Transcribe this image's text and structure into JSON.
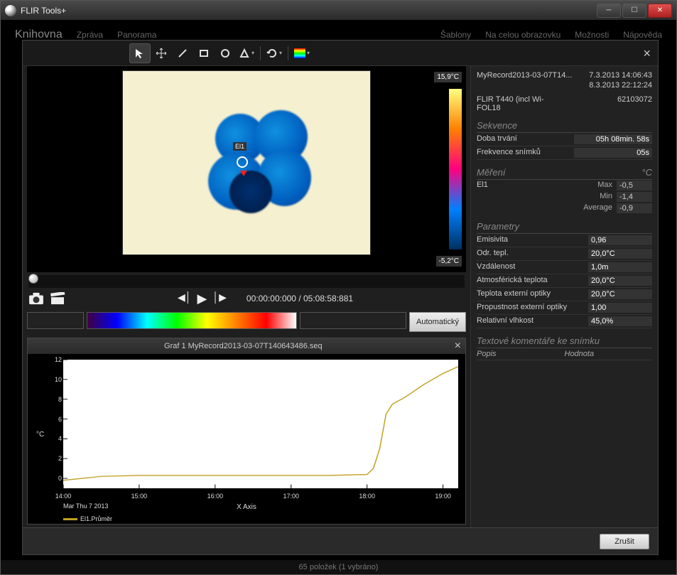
{
  "window": {
    "title": "FLIR Tools+"
  },
  "bg_menu": [
    "Knihovna",
    "Zpráva",
    "Panorama",
    "Šablony",
    "Na celou obrazovku",
    "Možnosti",
    "Nápověda"
  ],
  "toolbar": {
    "items": [
      "pointer",
      "move",
      "line",
      "rect",
      "circle",
      "delta",
      "rotate",
      "palette"
    ],
    "active": 0
  },
  "thermal": {
    "marker_label": "El1",
    "scale_max": "15,9°C",
    "scale_min": "-5,2°C"
  },
  "playback": {
    "current": "00:00:00:000",
    "total": "05:08:58:881"
  },
  "levelspan": {
    "auto_label": "Automatický"
  },
  "graph": {
    "title": "Graf 1 MyRecord2013-03-07T140643486.seq",
    "ylabel": "°C",
    "xlabel": "X Axis",
    "xdate": "Mar Thu 7 2013",
    "legend": "El1.Průměr"
  },
  "chart_data": {
    "type": "line",
    "title": "Graf 1 MyRecord2013-03-07T140643486.seq",
    "xlabel": "X Axis",
    "ylabel": "°C",
    "ylim": [
      -1,
      12
    ],
    "xticks": [
      "14:00",
      "15:00",
      "16:00",
      "17:00",
      "18:00",
      "19:00"
    ],
    "yticks": [
      0,
      2,
      4,
      6,
      8,
      10,
      12
    ],
    "series": [
      {
        "name": "El1.Průměr",
        "color": "#c0a020",
        "x": [
          "14:00",
          "14:30",
          "15:00",
          "15:30",
          "16:00",
          "16:30",
          "17:00",
          "17:30",
          "18:00",
          "18:05",
          "18:10",
          "18:15",
          "18:20",
          "18:30",
          "18:45",
          "19:00",
          "19:12"
        ],
        "y": [
          -0.2,
          0.2,
          0.3,
          0.3,
          0.3,
          0.3,
          0.3,
          0.3,
          0.4,
          1.0,
          3.0,
          6.5,
          7.5,
          8.2,
          9.5,
          10.6,
          11.3
        ]
      }
    ]
  },
  "meta": {
    "file": "MyRecord2013-03-07T14...",
    "date_start": "7.3.2013 14:06:43",
    "date_end": "8.3.2013 22:12:24",
    "camera": "FLIR T440 (incl Wi-FOL18",
    "serial": "62103072"
  },
  "sequence": {
    "header": "Sekvence",
    "rows": [
      {
        "k": "Doba trvání",
        "v": "05h 08min. 58s"
      },
      {
        "k": "Frekvence snímků",
        "v": "05s"
      }
    ]
  },
  "measurement": {
    "header": "Měření",
    "unit": "°C",
    "name": "El1",
    "rows": [
      {
        "b": "Max",
        "c": "-0,5"
      },
      {
        "b": "Min",
        "c": "-1,4"
      },
      {
        "b": "Average",
        "c": "-0,9"
      }
    ]
  },
  "parameters": {
    "header": "Parametry",
    "rows": [
      {
        "k": "Emisivita",
        "v": "0,96"
      },
      {
        "k": "Odr. tepl.",
        "v": "20,0°C"
      },
      {
        "k": "Vzdálenost",
        "v": "1,0m"
      },
      {
        "k": "Atmosférická teplota",
        "v": "20,0°C"
      },
      {
        "k": "Teplota externí optiky",
        "v": "20,0°C"
      },
      {
        "k": "Propustnost externí optiky",
        "v": "1,00"
      },
      {
        "k": "Relativní vlhkost",
        "v": "45,0%"
      }
    ]
  },
  "textcomments": {
    "header": "Textové komentáře ke snímku",
    "col1": "Popis",
    "col2": "Hodnota"
  },
  "footer": {
    "cancel": "Zrušit"
  },
  "statusbar": {
    "text": "65 položek   (1 vybráno)"
  }
}
